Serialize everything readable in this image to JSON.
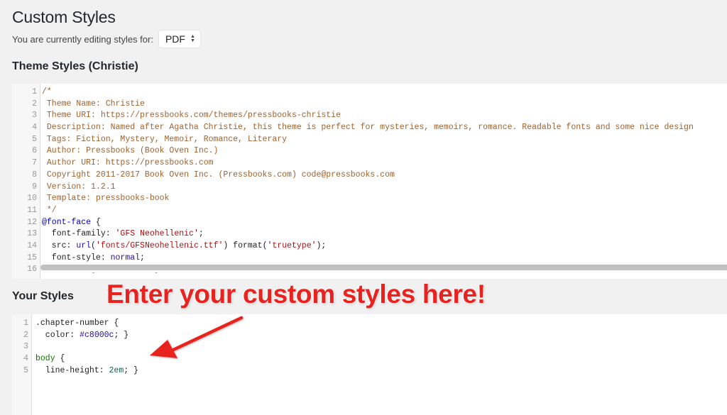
{
  "page": {
    "title": "Custom Styles",
    "editing_label": "You are currently editing styles for:",
    "format_select": {
      "selected": "PDF",
      "icon": "select-arrows-icon"
    }
  },
  "theme_styles": {
    "title": "Theme Styles (Christie)",
    "lines": [
      {
        "n": "1",
        "html": "<span class=\"c-comment\">/*</span>"
      },
      {
        "n": "2",
        "html": "<span class=\"c-comment\"> Theme Name: Christie</span>"
      },
      {
        "n": "3",
        "html": "<span class=\"c-comment\"> Theme URI: https://pressbooks.com/themes/pressbooks-christie</span>"
      },
      {
        "n": "4",
        "html": "<span class=\"c-comment\"> Description: Named after Agatha Christie, this theme is perfect for mysteries, memoirs, romance. Readable fonts and some nice design</span>"
      },
      {
        "n": "5",
        "html": "<span class=\"c-comment\"> Tags: Fiction, Mystery, Memoir, Romance, Literary</span>"
      },
      {
        "n": "6",
        "html": "<span class=\"c-comment\"> Author: Pressbooks (Book Oven Inc.)</span>"
      },
      {
        "n": "7",
        "html": "<span class=\"c-comment\"> Author URI: https://pressbooks.com</span>"
      },
      {
        "n": "8",
        "html": "<span class=\"c-comment\"> Copyright 2011-2017 Book Oven Inc. (Pressbooks.com) code@pressbooks.com</span>"
      },
      {
        "n": "9",
        "html": "<span class=\"c-comment\"> Version: 1.2.1</span>"
      },
      {
        "n": "10",
        "html": "<span class=\"c-comment\"> Template: pressbooks-book</span>"
      },
      {
        "n": "11",
        "html": "<span class=\"c-comment\"> */</span>"
      },
      {
        "n": "12",
        "html": "<span class=\"c-def\">@font-face</span> {"
      },
      {
        "n": "13",
        "html": "  font-family: <span class=\"c-string\">'GFS Neohellenic'</span>;"
      },
      {
        "n": "14",
        "html": "  src: <span class=\"c-atom\">url</span>(<span class=\"c-string\">'fonts/GFSNeohellenic.ttf'</span>) format(<span class=\"c-string\">'truetype'</span>);"
      },
      {
        "n": "15",
        "html": "  font-style: <span class=\"c-atom\">normal</span>;"
      },
      {
        "n": "16",
        "html": "  font-weight: <span class=\"c-atom\">normal</span>; }"
      }
    ]
  },
  "your_styles": {
    "title": "Your Styles",
    "lines": [
      {
        "n": "1",
        "html": ".chapter-number {"
      },
      {
        "n": "2",
        "html": "  color: <span class=\"c-atom\">#c8000c</span>; }"
      },
      {
        "n": "3",
        "html": ""
      },
      {
        "n": "4",
        "html": "<span class=\"c-tag\">body</span> {"
      },
      {
        "n": "5",
        "html": "  line-height: <span class=\"c-number\">2em</span>; }"
      }
    ]
  },
  "annotation": {
    "text": "Enter your custom styles here!",
    "color": "#e8221f",
    "icon": "arrow-pointer-icon"
  }
}
